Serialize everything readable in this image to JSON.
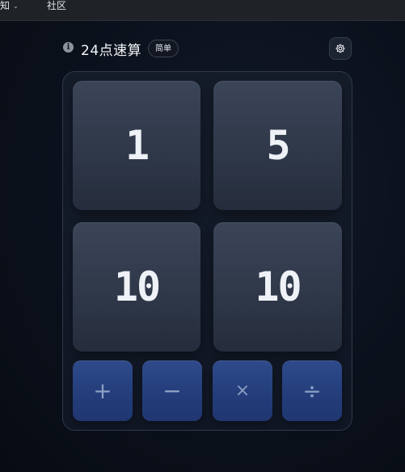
{
  "nav": {
    "items": [
      {
        "label": "知",
        "icon": "chevron-down-icon"
      },
      {
        "label": "社区"
      }
    ]
  },
  "header": {
    "title": "24点速算",
    "difficulty_badge": "简单",
    "info_icon": "info-icon",
    "settings_icon": "gear-icon"
  },
  "cards": [
    {
      "value": "1"
    },
    {
      "value": "5"
    },
    {
      "value": "10"
    },
    {
      "value": "10"
    }
  ],
  "operators": [
    {
      "symbol": "+"
    },
    {
      "symbol": "−"
    },
    {
      "symbol": "×"
    },
    {
      "symbol": "÷"
    }
  ],
  "colors": {
    "background": "#0b111c",
    "card": "#323b4d",
    "operator_button": "#27407f",
    "text": "#eef1f6"
  }
}
